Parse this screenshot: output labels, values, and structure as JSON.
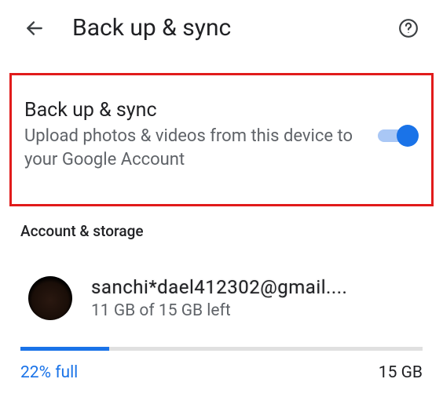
{
  "header": {
    "title": "Back up & sync"
  },
  "backup_sync": {
    "title": "Back up & sync",
    "subtitle": "Upload photos & videos from this device to your Google Account",
    "enabled": true
  },
  "section_header": "Account & storage",
  "account": {
    "email_display": "sanchi*dael412302@gmail....",
    "storage_left": "11 GB of 15 GB left"
  },
  "storage": {
    "percent_full_label": "22% full",
    "percent_full_value": 22,
    "total_label": "15 GB"
  },
  "colors": {
    "accent": "#1a73e8",
    "highlight_border": "#e11b1b"
  }
}
